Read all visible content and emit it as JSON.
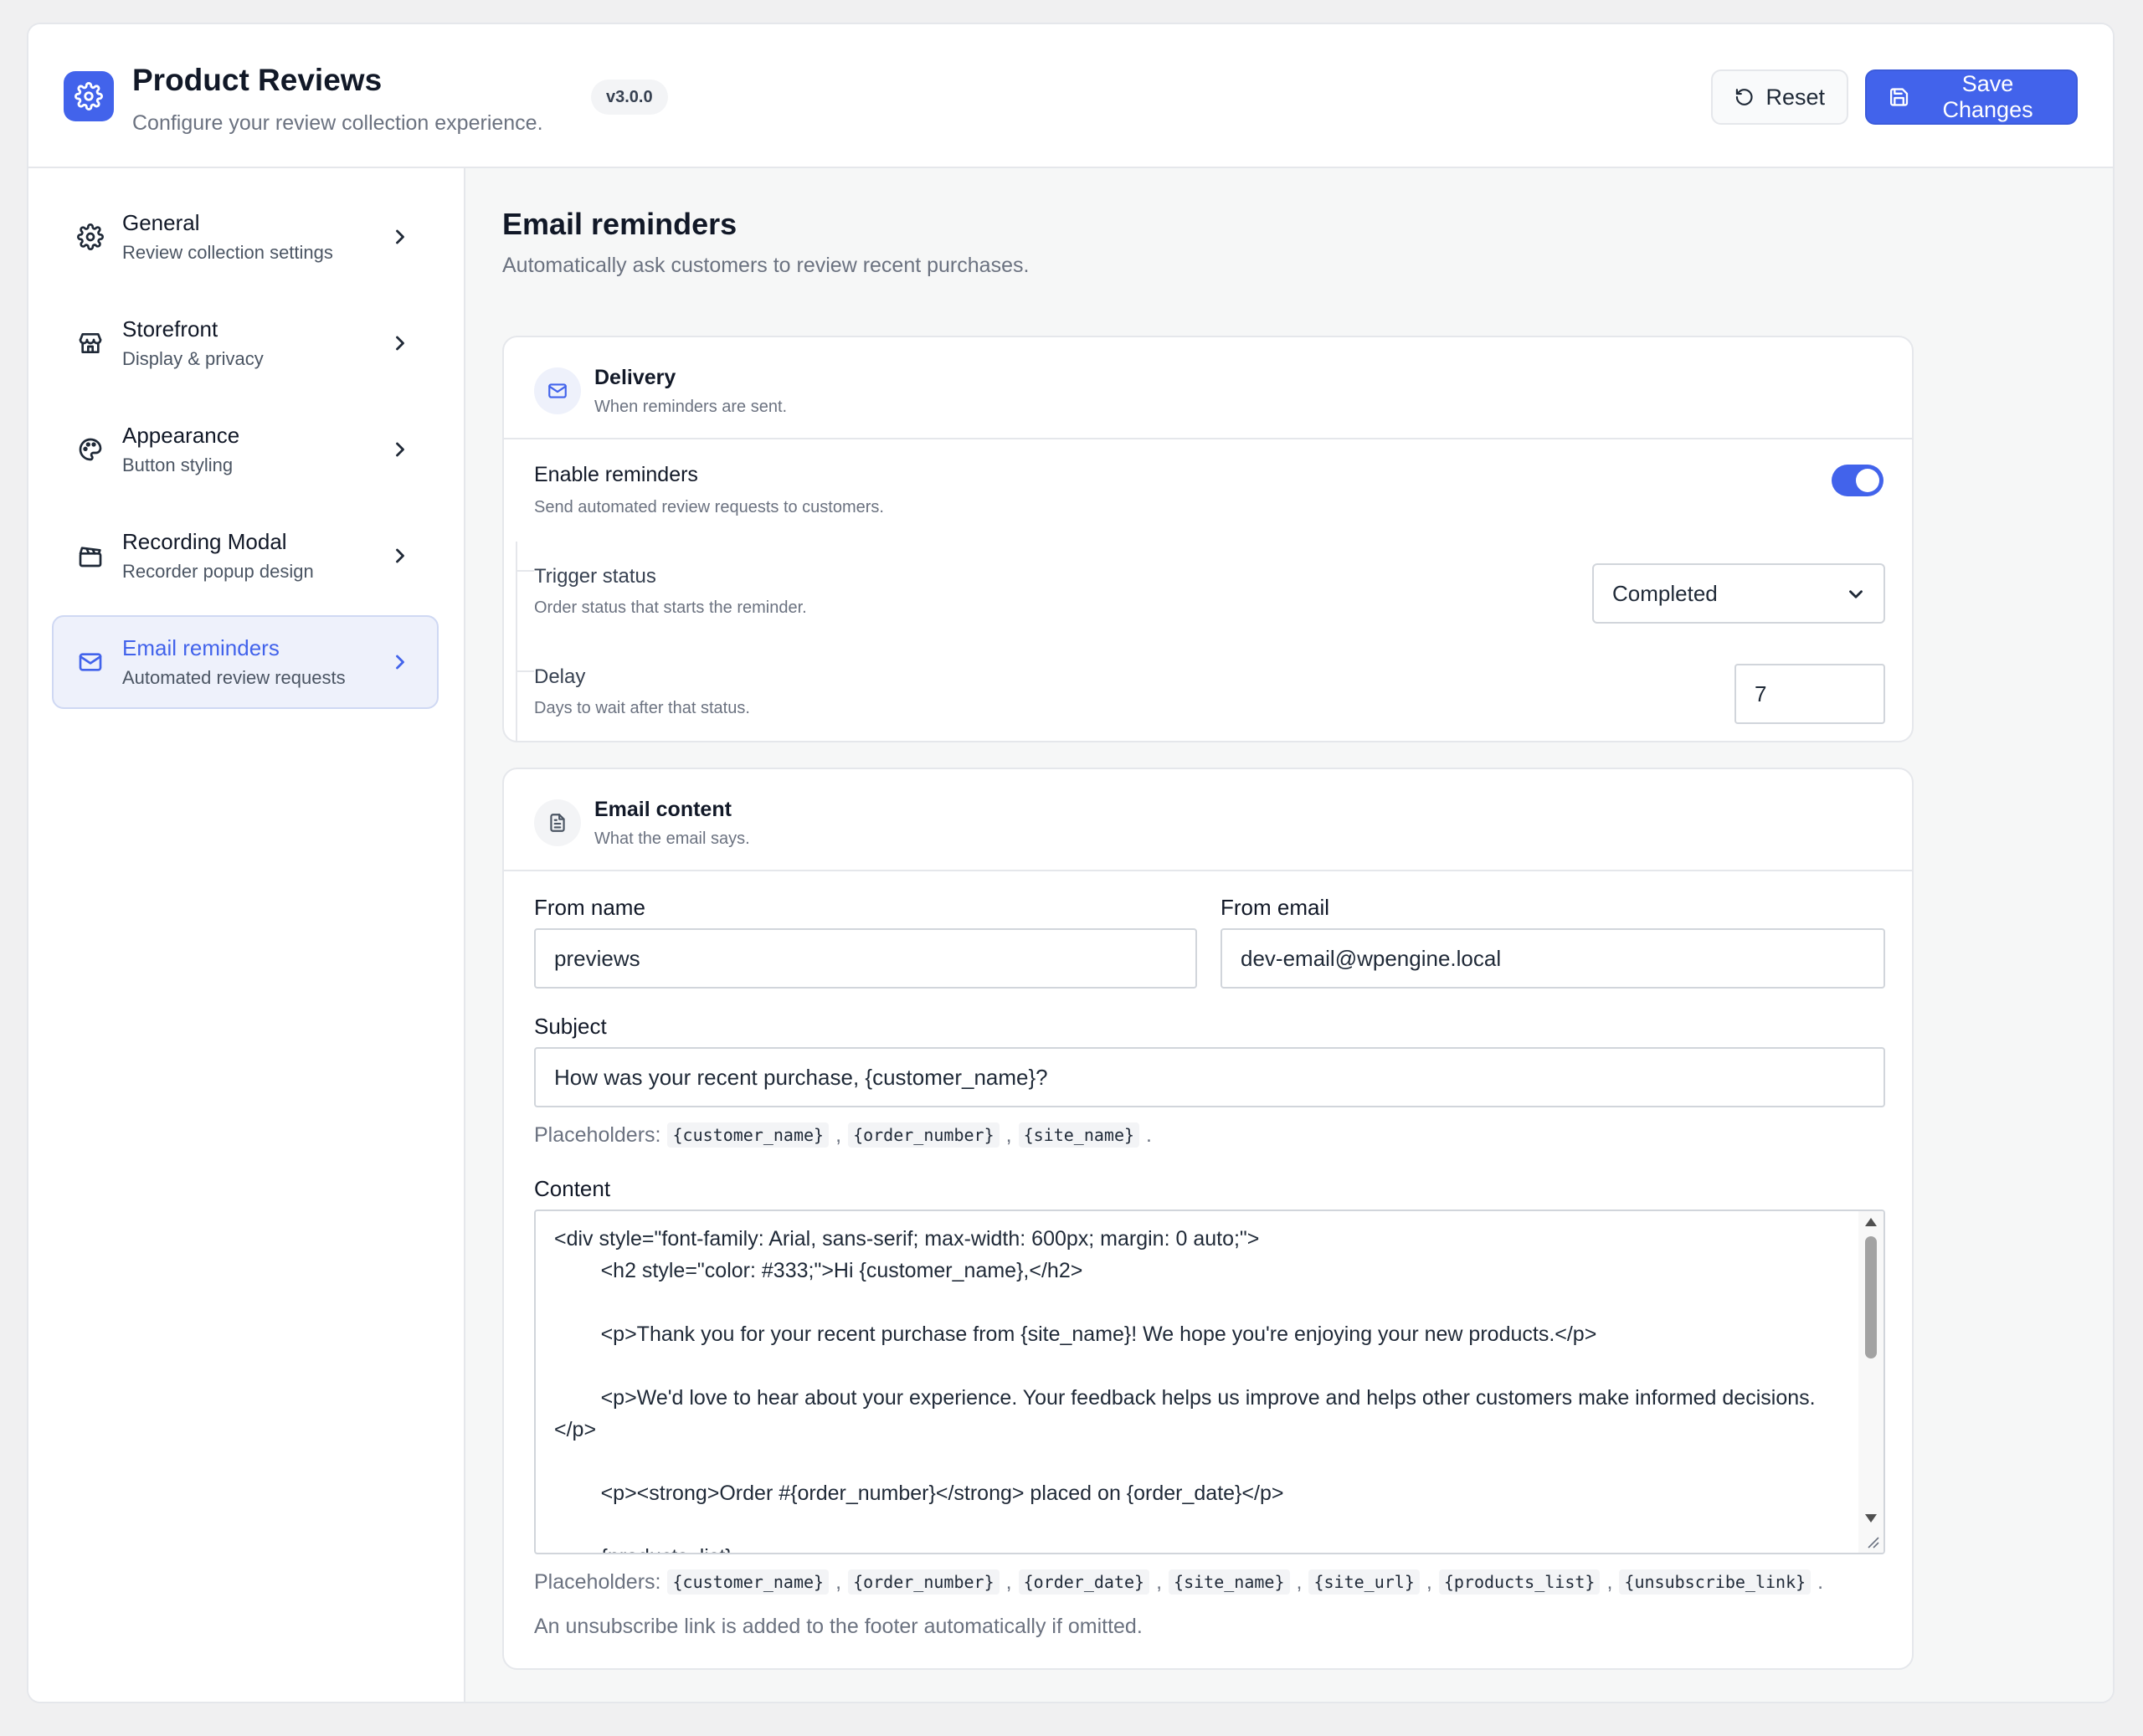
{
  "header": {
    "title": "Product Reviews",
    "subtitle": "Configure your review collection experience.",
    "version": "v3.0.0",
    "reset_label": "Reset",
    "save_label": "Save Changes"
  },
  "sidebar": {
    "items": [
      {
        "label": "General",
        "desc": "Review collection settings",
        "icon": "gear-icon"
      },
      {
        "label": "Storefront",
        "desc": "Display & privacy",
        "icon": "store-icon"
      },
      {
        "label": "Appearance",
        "desc": "Button styling",
        "icon": "palette-icon"
      },
      {
        "label": "Recording Modal",
        "desc": "Recorder popup design",
        "icon": "clapperboard-icon"
      },
      {
        "label": "Email reminders",
        "desc": "Automated review requests",
        "icon": "mail-icon",
        "active": true
      }
    ]
  },
  "main": {
    "title": "Email reminders",
    "desc": "Automatically ask customers to review recent purchases.",
    "delivery": {
      "title": "Delivery",
      "subtitle": "When reminders are sent.",
      "enable_label": "Enable reminders",
      "enable_desc": "Send automated review requests to customers.",
      "enabled": true,
      "trigger_label": "Trigger status",
      "trigger_desc": "Order status that starts the reminder.",
      "trigger_value": "Completed",
      "delay_label": "Delay",
      "delay_desc": "Days to wait after that status.",
      "delay_value": "7"
    },
    "content": {
      "title": "Email content",
      "subtitle": "What the email says.",
      "from_name_label": "From name",
      "from_name_value": "previews",
      "from_email_label": "From email",
      "from_email_value": "dev-email@wpengine.local",
      "subject_label": "Subject",
      "subject_value": "How was your recent purchase, {customer_name}?",
      "placeholders_label": "Placeholders:",
      "subject_placeholders": [
        "{customer_name}",
        "{order_number}",
        "{site_name}"
      ],
      "content_label": "Content",
      "content_value": "<div style=\"font-family: Arial, sans-serif; max-width: 600px; margin: 0 auto;\">\n        <h2 style=\"color: #333;\">Hi {customer_name},</h2>\n\n        <p>Thank you for your recent purchase from {site_name}! We hope you're enjoying your new products.</p>\n\n        <p>We'd love to hear about your experience. Your feedback helps us improve and helps other customers make informed decisions.</p>\n\n        <p><strong>Order #{order_number}</strong> placed on {order_date}</p>\n\n        {products_list}",
      "content_placeholders": [
        "{customer_name}",
        "{order_number}",
        "{order_date}",
        "{site_name}",
        "{site_url}",
        "{products_list}",
        "{unsubscribe_link}"
      ],
      "note": "An unsubscribe link is added to the footer automatically if omitted."
    }
  },
  "colors": {
    "accent": "#4263eb",
    "active_bg": "#eef1fb"
  }
}
